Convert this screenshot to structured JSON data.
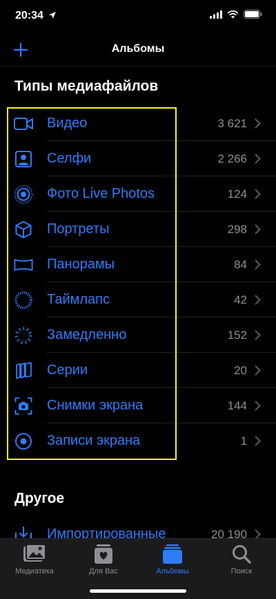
{
  "status": {
    "time": "20:34"
  },
  "nav": {
    "title": "Альбомы"
  },
  "media_types": {
    "title": "Типы медиафайлов",
    "items": [
      {
        "label": "Видео",
        "count": "3 621"
      },
      {
        "label": "Селфи",
        "count": "2 266"
      },
      {
        "label": "Фото Live Photos",
        "count": "124"
      },
      {
        "label": "Портреты",
        "count": "298"
      },
      {
        "label": "Панорамы",
        "count": "84"
      },
      {
        "label": "Таймлапс",
        "count": "42"
      },
      {
        "label": "Замедленно",
        "count": "152"
      },
      {
        "label": "Серии",
        "count": "20"
      },
      {
        "label": "Снимки экрана",
        "count": "144"
      },
      {
        "label": "Записи экрана",
        "count": "1"
      }
    ]
  },
  "other": {
    "title": "Другое",
    "items": [
      {
        "label": "Импортированные",
        "count": "20 190"
      }
    ]
  },
  "tabs": [
    {
      "label": "Медиатека"
    },
    {
      "label": "Для Вас"
    },
    {
      "label": "Альбомы"
    },
    {
      "label": "Поиск"
    }
  ],
  "colors": {
    "accent": "#2f7cf6",
    "highlight": "#f5f22a"
  }
}
